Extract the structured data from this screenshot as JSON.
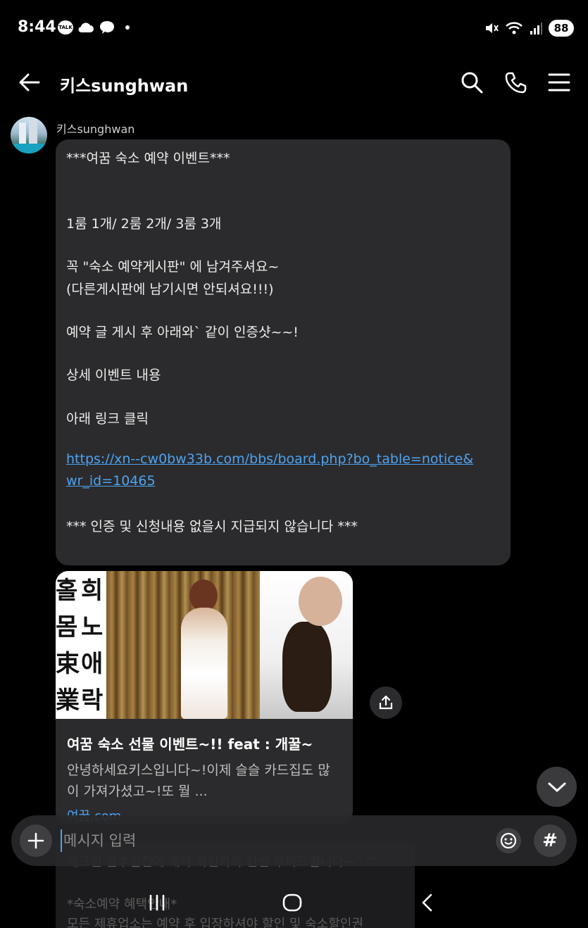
{
  "status_bar": {
    "time": "8:44",
    "talk_badge": "TALK",
    "battery": "88",
    "icons": [
      "kakaotalk-icon",
      "cloud-icon",
      "chat-bubble-icon",
      "dot-icon",
      "mute-icon",
      "wifi-icon",
      "signal-icon",
      "battery-icon"
    ]
  },
  "app_bar": {
    "title": "키스sunghwan",
    "icons": [
      "back-arrow-icon",
      "search-icon",
      "phone-icon",
      "menu-icon"
    ]
  },
  "message": {
    "sender": "키스sunghwan",
    "lines": [
      "***여꿈 숙소 예약 이벤트***",
      "1룸 1개/ 2룸 2개/ 3룸 3개",
      "꼭  \"숙소 예약게시판\" 에 남겨주셔요~",
      "(다른게시판에 남기시면 안되셔요!!!)",
      "예약 글 게시 후 아래와` 같이 인증샷~~!",
      "상세 이벤트 내용",
      "아래 링크 클릭",
      "*** 인증 및 신청내용 없을시 지급되지 않습니다 ***"
    ],
    "link_line1": "https://xn--cw0bw33b.com/bbs/board.php?bo_table=notice&",
    "link_line2": "wr_id=10465"
  },
  "link_preview": {
    "image_calligraphy": [
      "홀",
      "몸",
      "束",
      "業",
      "희",
      "노",
      "애",
      "락"
    ],
    "title": "여꿈 숙소 선물 이벤트~!! feat : 개꿀~",
    "description": "안녕하세요키스입니다~!이제 슬슬 카드집도 많이 가져가셨고~!또 뭘 ...",
    "domain": "여꿈.com"
  },
  "behind_message": {
    "lines": [
      "체크인 월수일전에 예약 확인카톡 한번 부탁드립니다~^^",
      "*숙소예약 혜택안내*",
      "모든 제휴업소는 예약 후 입장하셔야 할인 및 숙소할인권"
    ]
  },
  "composer": {
    "placeholder": "메시지 입력",
    "icons": [
      "plus-icon",
      "emoji-icon",
      "hashtag-icon"
    ],
    "hash_label": "#"
  },
  "nav_bar": {
    "icons": [
      "recent-apps-icon",
      "home-icon",
      "back-icon"
    ]
  },
  "colors": {
    "background": "#000000",
    "bubble": "#2b2b2d",
    "link": "#4ea3f0"
  }
}
